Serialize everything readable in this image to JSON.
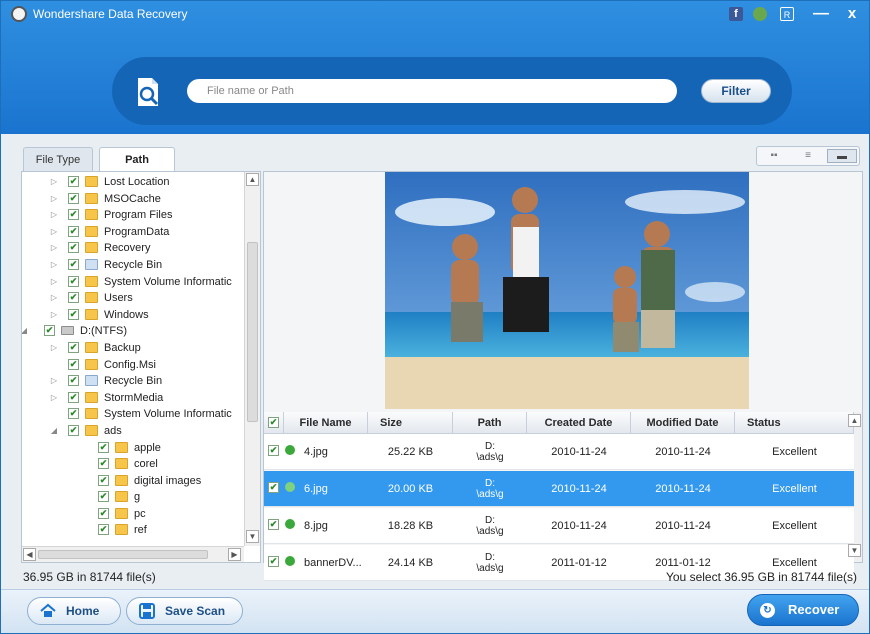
{
  "window": {
    "title": "Wondershare Data Recovery"
  },
  "titlebar": {
    "facebook_icon": "f",
    "register_icon": "R",
    "minimize_icon": "—",
    "close_icon": "x"
  },
  "search": {
    "placeholder": "File name or Path",
    "filter_label": "Filter"
  },
  "tabs": [
    {
      "label": "File Type",
      "active": false
    },
    {
      "label": "Path",
      "active": true
    }
  ],
  "tree": [
    {
      "label": "Lost Location",
      "icon": "folder",
      "indent": 0,
      "expander": "▷"
    },
    {
      "label": "MSOCache",
      "icon": "folder",
      "indent": 0,
      "expander": "▷"
    },
    {
      "label": "Program Files",
      "icon": "folder",
      "indent": 0,
      "expander": "▷"
    },
    {
      "label": "ProgramData",
      "icon": "folder",
      "indent": 0,
      "expander": "▷"
    },
    {
      "label": "Recovery",
      "icon": "folder",
      "indent": 0,
      "expander": "▷"
    },
    {
      "label": "Recycle Bin",
      "icon": "recycle-bin",
      "indent": 0,
      "expander": "▷"
    },
    {
      "label": "System Volume Informatic",
      "icon": "folder",
      "indent": 0,
      "expander": "▷"
    },
    {
      "label": "Users",
      "icon": "folder",
      "indent": 0,
      "expander": "▷"
    },
    {
      "label": "Windows",
      "icon": "folder",
      "indent": 0,
      "expander": "▷"
    },
    {
      "label": "D:(NTFS)",
      "icon": "drive",
      "indent": -1,
      "expander": "◢"
    },
    {
      "label": "Backup",
      "icon": "folder",
      "indent": 0,
      "expander": "▷"
    },
    {
      "label": "Config.Msi",
      "icon": "folder",
      "indent": 0,
      "expander": ""
    },
    {
      "label": "Recycle Bin",
      "icon": "recycle-bin",
      "indent": 0,
      "expander": "▷"
    },
    {
      "label": "StormMedia",
      "icon": "folder",
      "indent": 0,
      "expander": "▷"
    },
    {
      "label": "System Volume Informatic",
      "icon": "folder",
      "indent": 0,
      "expander": ""
    },
    {
      "label": "ads",
      "icon": "folder",
      "indent": 0,
      "expander": "◢"
    },
    {
      "label": "apple",
      "icon": "folder",
      "indent": 1,
      "expander": ""
    },
    {
      "label": "corel",
      "icon": "folder",
      "indent": 1,
      "expander": ""
    },
    {
      "label": "digital images",
      "icon": "folder",
      "indent": 1,
      "expander": ""
    },
    {
      "label": "g",
      "icon": "folder",
      "indent": 1,
      "expander": ""
    },
    {
      "label": "pc",
      "icon": "folder",
      "indent": 1,
      "expander": ""
    },
    {
      "label": "ref",
      "icon": "folder",
      "indent": 1,
      "expander": ""
    }
  ],
  "table": {
    "columns": [
      "File Name",
      "Size",
      "Path",
      "Created Date",
      "Modified Date",
      "Status"
    ],
    "rows": [
      {
        "name": "4.jpg",
        "size": "25.22 KB",
        "path_line1": "D:",
        "path_line2": "\\ads\\g",
        "created": "2010-11-24",
        "modified": "2010-11-24",
        "status": "Excellent",
        "selected": false
      },
      {
        "name": "6.jpg",
        "size": "20.00 KB",
        "path_line1": "D:",
        "path_line2": "\\ads\\g",
        "created": "2010-11-24",
        "modified": "2010-11-24",
        "status": "Excellent",
        "selected": true
      },
      {
        "name": "8.jpg",
        "size": "18.28 KB",
        "path_line1": "D:",
        "path_line2": "\\ads\\g",
        "created": "2010-11-24",
        "modified": "2010-11-24",
        "status": "Excellent",
        "selected": false
      },
      {
        "name": "bannerDV...",
        "size": "24.14 KB",
        "path_line1": "D:",
        "path_line2": "\\ads\\g",
        "created": "2011-01-12",
        "modified": "2011-01-12",
        "status": "Excellent",
        "selected": false
      }
    ]
  },
  "status": {
    "left": "36.95 GB in 81744 file(s)",
    "right": "You select 36.95 GB in 81744 file(s)"
  },
  "buttons": {
    "home": "Home",
    "save_scan": "Save Scan",
    "recover": "Recover"
  },
  "colors": {
    "accent": "#1a74cf",
    "selection": "#3399ee",
    "status_ok": "#3aa83a"
  }
}
